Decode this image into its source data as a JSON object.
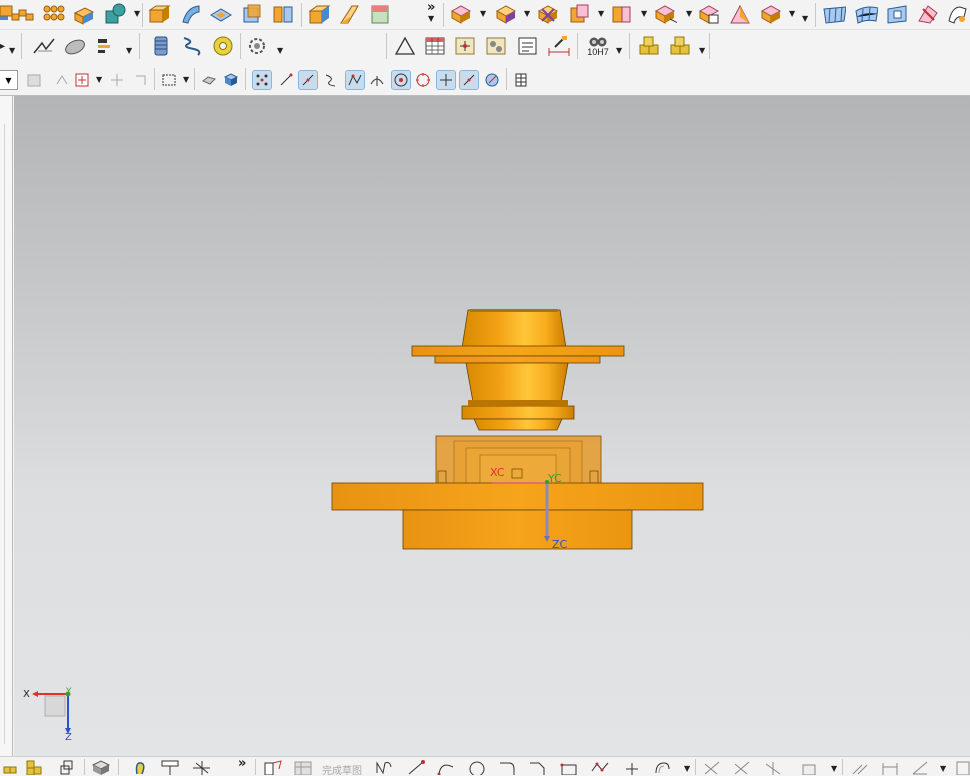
{
  "toolbar_row1": {
    "overflow_label": "»",
    "icons": [
      "block-feature-icon",
      "pattern-feature-icon",
      "pattern-face-icon",
      "unite-icon",
      "combine-dropdown-icon",
      "box-icon",
      "swept-icon",
      "emboss-sheet-icon",
      "bounding-body-icon",
      "split-body-icon",
      "box-solid-icon",
      "sheet-fold-icon",
      "gradient-box-icon",
      "move-face-icon",
      "offset-face-icon",
      "delete-face-icon",
      "replace-face-icon",
      "resize-face-icon",
      "pull-face-icon",
      "draft-face-icon",
      "pattern-face-copy-icon",
      "studio-surface-icon",
      "through-curves-icon",
      "surface-grid-icon",
      "trim-sheet-icon",
      "parting-surface-icon"
    ]
  },
  "toolbar_row2": {
    "icons": [
      "curve-icon",
      "surface-icon",
      "offset-curve-icon",
      "thread-icon",
      "spring-icon",
      "washer-icon",
      "gear-icon",
      "triangle-sketch-icon",
      "table-icon",
      "point-cloud-icon",
      "component-icon",
      "text-note-icon",
      "measure-icon",
      "tolerance-icon",
      "assembly-icon",
      "add-component-icon"
    ],
    "tolerance_label": "10H7"
  },
  "toolbar_row3": {
    "icons": [
      "filter-combo",
      "hide-icon",
      "show-icon",
      "snap-point-icon",
      "selection-box-icon",
      "feature-selection-icon",
      "select-face-icon",
      "shaded-view-icon",
      "snap-endpoint-icon",
      "snap-midpoint-icon",
      "snap-line-icon",
      "snap-curve-icon",
      "snap-arc-icon",
      "snap-center-icon",
      "snap-quadrant-icon",
      "snap-intersection-icon",
      "snap-tangent-icon",
      "snap-face-icon",
      "grid-view-icon"
    ]
  },
  "viewport": {
    "wcs": {
      "x_label": "XC",
      "y_label": "YC",
      "z_label": "ZC"
    },
    "absolute_triad": {
      "x_label": "X",
      "y_label": "Y",
      "z_label": "Z"
    },
    "colors": {
      "part_orange": "#f0a020",
      "part_dark": "#c47e00",
      "part_light": "#ffcc40",
      "x_axis": "#e03030",
      "y_axis": "#30a030",
      "z_axis": "#3050d0"
    }
  },
  "bottom_toolbar": {
    "finish_sketch_label": "完成草图",
    "overflow_label": "»"
  }
}
